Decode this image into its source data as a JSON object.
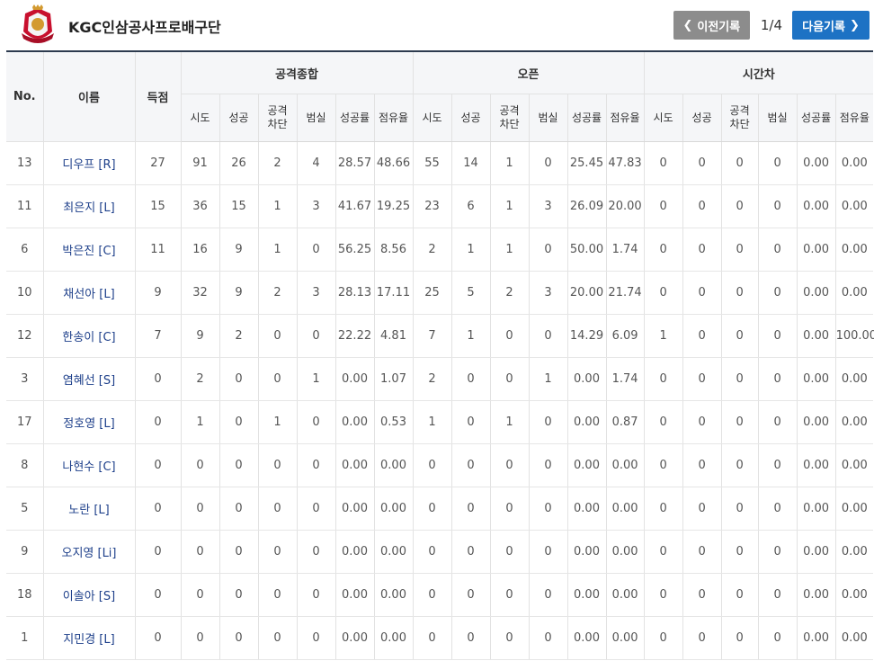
{
  "header": {
    "team_name": "KGC인삼공사프로배구단",
    "prev_label": "이전기록",
    "next_label": "다음기록",
    "page_indicator": "1/4"
  },
  "table": {
    "columns": {
      "no": "No.",
      "name": "이름",
      "score": "득점",
      "groups": [
        "공격종합",
        "오픈",
        "시간차"
      ],
      "sub": [
        "시도",
        "성공",
        "공격\n차단",
        "범실",
        "성공률",
        "점유율"
      ]
    },
    "rows": [
      {
        "no": "13",
        "name": "디우프 [R]",
        "score": "27",
        "g1": [
          "91",
          "26",
          "2",
          "4",
          "28.57",
          "48.66"
        ],
        "g2": [
          "55",
          "14",
          "1",
          "0",
          "25.45",
          "47.83"
        ],
        "g3": [
          "0",
          "0",
          "0",
          "0",
          "0.00",
          "0.00"
        ]
      },
      {
        "no": "11",
        "name": "최은지 [L]",
        "score": "15",
        "g1": [
          "36",
          "15",
          "1",
          "3",
          "41.67",
          "19.25"
        ],
        "g2": [
          "23",
          "6",
          "1",
          "3",
          "26.09",
          "20.00"
        ],
        "g3": [
          "0",
          "0",
          "0",
          "0",
          "0.00",
          "0.00"
        ]
      },
      {
        "no": "6",
        "name": "박은진 [C]",
        "score": "11",
        "g1": [
          "16",
          "9",
          "1",
          "0",
          "56.25",
          "8.56"
        ],
        "g2": [
          "2",
          "1",
          "1",
          "0",
          "50.00",
          "1.74"
        ],
        "g3": [
          "0",
          "0",
          "0",
          "0",
          "0.00",
          "0.00"
        ]
      },
      {
        "no": "10",
        "name": "채선아 [L]",
        "score": "9",
        "g1": [
          "32",
          "9",
          "2",
          "3",
          "28.13",
          "17.11"
        ],
        "g2": [
          "25",
          "5",
          "2",
          "3",
          "20.00",
          "21.74"
        ],
        "g3": [
          "0",
          "0",
          "0",
          "0",
          "0.00",
          "0.00"
        ]
      },
      {
        "no": "12",
        "name": "한송이 [C]",
        "score": "7",
        "g1": [
          "9",
          "2",
          "0",
          "0",
          "22.22",
          "4.81"
        ],
        "g2": [
          "7",
          "1",
          "0",
          "0",
          "14.29",
          "6.09"
        ],
        "g3": [
          "1",
          "0",
          "0",
          "0",
          "0.00",
          "100.00"
        ]
      },
      {
        "no": "3",
        "name": "염혜선 [S]",
        "score": "0",
        "g1": [
          "2",
          "0",
          "0",
          "1",
          "0.00",
          "1.07"
        ],
        "g2": [
          "2",
          "0",
          "0",
          "1",
          "0.00",
          "1.74"
        ],
        "g3": [
          "0",
          "0",
          "0",
          "0",
          "0.00",
          "0.00"
        ]
      },
      {
        "no": "17",
        "name": "정호영 [L]",
        "score": "0",
        "g1": [
          "1",
          "0",
          "1",
          "0",
          "0.00",
          "0.53"
        ],
        "g2": [
          "1",
          "0",
          "1",
          "0",
          "0.00",
          "0.87"
        ],
        "g3": [
          "0",
          "0",
          "0",
          "0",
          "0.00",
          "0.00"
        ]
      },
      {
        "no": "8",
        "name": "나현수 [C]",
        "score": "0",
        "g1": [
          "0",
          "0",
          "0",
          "0",
          "0.00",
          "0.00"
        ],
        "g2": [
          "0",
          "0",
          "0",
          "0",
          "0.00",
          "0.00"
        ],
        "g3": [
          "0",
          "0",
          "0",
          "0",
          "0.00",
          "0.00"
        ]
      },
      {
        "no": "5",
        "name": "노란 [L]",
        "score": "0",
        "g1": [
          "0",
          "0",
          "0",
          "0",
          "0.00",
          "0.00"
        ],
        "g2": [
          "0",
          "0",
          "0",
          "0",
          "0.00",
          "0.00"
        ],
        "g3": [
          "0",
          "0",
          "0",
          "0",
          "0.00",
          "0.00"
        ]
      },
      {
        "no": "9",
        "name": "오지영 [Li]",
        "score": "0",
        "g1": [
          "0",
          "0",
          "0",
          "0",
          "0.00",
          "0.00"
        ],
        "g2": [
          "0",
          "0",
          "0",
          "0",
          "0.00",
          "0.00"
        ],
        "g3": [
          "0",
          "0",
          "0",
          "0",
          "0.00",
          "0.00"
        ]
      },
      {
        "no": "18",
        "name": "이솔아 [S]",
        "score": "0",
        "g1": [
          "0",
          "0",
          "0",
          "0",
          "0.00",
          "0.00"
        ],
        "g2": [
          "0",
          "0",
          "0",
          "0",
          "0.00",
          "0.00"
        ],
        "g3": [
          "0",
          "0",
          "0",
          "0",
          "0.00",
          "0.00"
        ]
      },
      {
        "no": "1",
        "name": "지민경 [L]",
        "score": "0",
        "g1": [
          "0",
          "0",
          "0",
          "0",
          "0.00",
          "0.00"
        ],
        "g2": [
          "0",
          "0",
          "0",
          "0",
          "0.00",
          "0.00"
        ],
        "g3": [
          "0",
          "0",
          "0",
          "0",
          "0.00",
          "0.00"
        ]
      }
    ]
  },
  "colors": {
    "accent": "#1d72c4",
    "prev_button": "#8c8c8c",
    "header_bg": "#f5f6f8",
    "name_link": "#1d3f8a"
  }
}
